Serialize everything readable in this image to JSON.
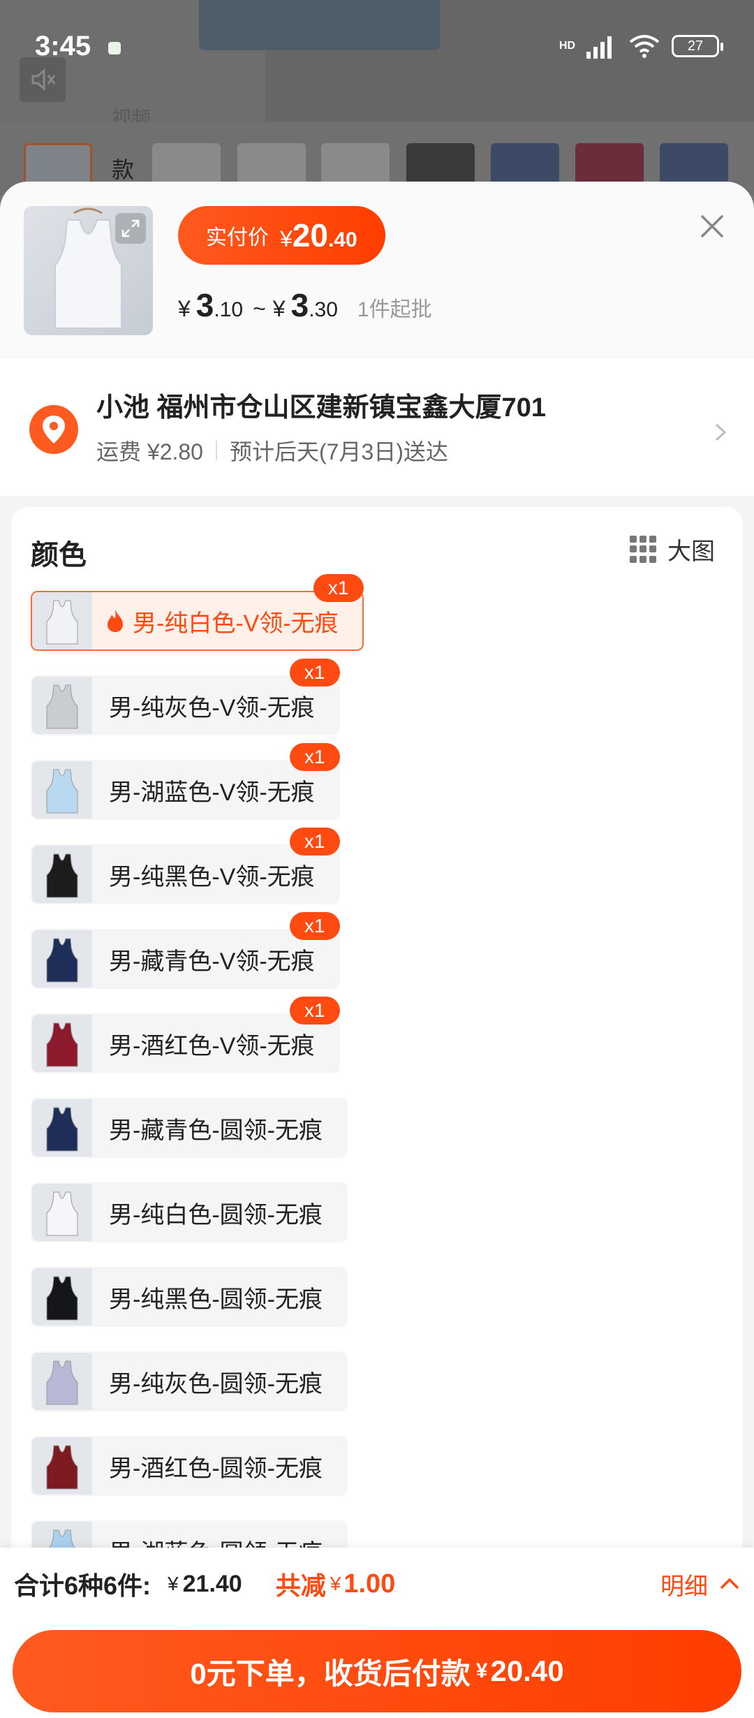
{
  "status": {
    "time": "3:45",
    "network": "HD",
    "battery": "27"
  },
  "background": {
    "tab_label": "视频",
    "style_label": "款"
  },
  "header": {
    "pay_label": "实付价",
    "pay_currency": "¥",
    "pay_int": "20",
    "pay_dec": ".40",
    "range_currency": "¥",
    "range_low_int": "3",
    "range_low_dec": ".10",
    "range_sep": "~",
    "range_high_int": "3",
    "range_high_dec": ".30",
    "min_order": "1件起批"
  },
  "address": {
    "name_line": "小池 福州市仓山区建新镇宝鑫大厦701",
    "shipping": "运费 ¥2.80",
    "delivery": "预计后天(7月3日)送达"
  },
  "colors": {
    "title": "颜色",
    "big_image": "大图",
    "items": [
      {
        "label": "男-纯白色-V领-无痕",
        "qty": "x1",
        "swatch": "#f0f2f5",
        "selected": true
      },
      {
        "label": "男-纯灰色-V领-无痕",
        "qty": "x1",
        "swatch": "#c9ccd1"
      },
      {
        "label": "男-湖蓝色-V领-无痕",
        "qty": "x1",
        "swatch": "#b9d9f0"
      },
      {
        "label": "男-纯黑色-V领-无痕",
        "qty": "x1",
        "swatch": "#1c1c1c"
      },
      {
        "label": "男-藏青色-V领-无痕",
        "qty": "x1",
        "swatch": "#1e2e58"
      },
      {
        "label": "男-酒红色-V领-无痕",
        "qty": "x1",
        "swatch": "#8c1a2c"
      },
      {
        "label": "男-藏青色-圆领-无痕",
        "swatch": "#1e2e58"
      },
      {
        "label": "男-纯白色-圆领-无痕",
        "swatch": "#f6f6f8"
      },
      {
        "label": "男-纯黑色-圆领-无痕",
        "swatch": "#15161b"
      },
      {
        "label": "男-纯灰色-圆领-无痕",
        "swatch": "#b9b7d6"
      },
      {
        "label": "男-酒红色-圆领-无痕",
        "swatch": "#7e1a22"
      },
      {
        "label": "男-湖蓝色-圆领-无痕",
        "swatch": "#a9d1ef"
      }
    ]
  },
  "footer": {
    "summary": "合计6种6件:",
    "total_currency": "¥",
    "total": "21.40",
    "discount_label": "共减",
    "discount_currency": "¥",
    "discount": "1.00",
    "detail": "明细",
    "order_text": "0元下单，收货后付款",
    "order_currency": "¥",
    "order_amount": "20.40"
  },
  "accent": "#ff4a12"
}
